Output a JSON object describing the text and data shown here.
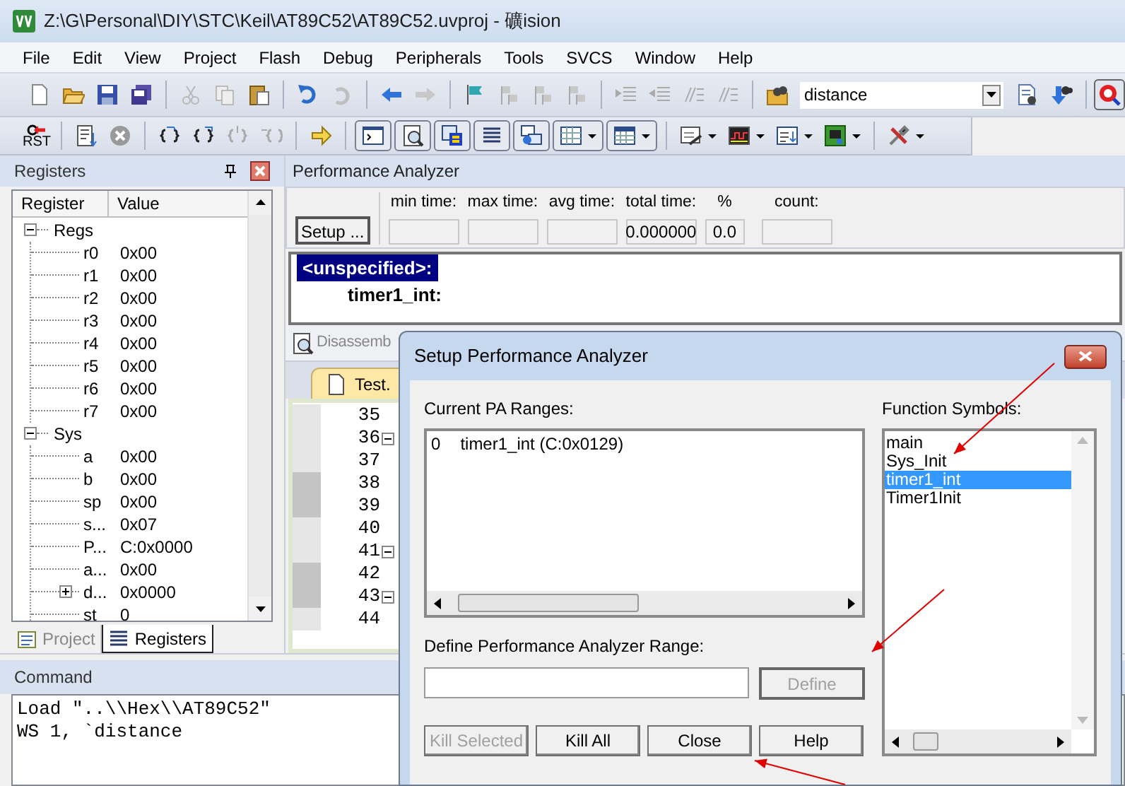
{
  "window": {
    "title": "Z:\\G\\Personal\\DIY\\STC\\Keil\\AT89C52\\AT89C52.uvproj - 礦ision"
  },
  "menu": [
    "File",
    "Edit",
    "View",
    "Project",
    "Flash",
    "Debug",
    "Peripherals",
    "Tools",
    "SVCS",
    "Window",
    "Help"
  ],
  "toolbar": {
    "search": {
      "value": "distance"
    },
    "reset_label": "RST"
  },
  "registers_panel": {
    "title": "Registers",
    "columns": [
      "Register",
      "Value"
    ],
    "tree": [
      {
        "name": "Regs",
        "expanded": true,
        "children": [
          {
            "name": "r0",
            "value": "0x00"
          },
          {
            "name": "r1",
            "value": "0x00"
          },
          {
            "name": "r2",
            "value": "0x00"
          },
          {
            "name": "r3",
            "value": "0x00"
          },
          {
            "name": "r4",
            "value": "0x00"
          },
          {
            "name": "r5",
            "value": "0x00"
          },
          {
            "name": "r6",
            "value": "0x00"
          },
          {
            "name": "r7",
            "value": "0x00"
          }
        ]
      },
      {
        "name": "Sys",
        "expanded": true,
        "children": [
          {
            "name": "a",
            "value": "0x00"
          },
          {
            "name": "b",
            "value": "0x00"
          },
          {
            "name": "sp",
            "value": "0x00"
          },
          {
            "name": "s...",
            "value": "0x07"
          },
          {
            "name": "P...",
            "value": "C:0x0000"
          },
          {
            "name": "a...",
            "value": "0x00"
          },
          {
            "name": "d...",
            "value": "0x0000",
            "expanded": false
          },
          {
            "name": "st",
            "value": "0"
          }
        ]
      }
    ],
    "tabs": [
      {
        "label": "Project",
        "selected": false
      },
      {
        "label": "Registers",
        "selected": true
      }
    ]
  },
  "performance_analyzer": {
    "title": "Performance Analyzer",
    "setup_button": "Setup ...",
    "fields": [
      {
        "label": "min time:"
      },
      {
        "label": "max time:"
      },
      {
        "label": "avg time:"
      },
      {
        "label": "total time:",
        "value": "0.000000"
      },
      {
        "label": "%",
        "value": "0.0"
      },
      {
        "label": "count:"
      }
    ],
    "ranges": [
      {
        "label": "<unspecified>:",
        "selected": true
      },
      {
        "label": "timer1_int:",
        "selected": false
      }
    ]
  },
  "disassembly_tab": {
    "label": "Disassemb"
  },
  "editor": {
    "tab": "Test.",
    "lines": [
      {
        "number": "35",
        "fold": false,
        "marked": false
      },
      {
        "number": "36",
        "fold": true,
        "marked": false
      },
      {
        "number": "37",
        "fold": false,
        "marked": false
      },
      {
        "number": "38",
        "fold": false,
        "marked": true
      },
      {
        "number": "39",
        "fold": false,
        "marked": true
      },
      {
        "number": "40",
        "fold": false,
        "marked": false
      },
      {
        "number": "41",
        "fold": true,
        "marked": false
      },
      {
        "number": "42",
        "fold": false,
        "marked": true
      },
      {
        "number": "43",
        "fold": true,
        "marked": true
      },
      {
        "number": "44",
        "fold": false,
        "marked": false
      }
    ]
  },
  "command": {
    "title": "Command",
    "lines": [
      "Load \"..\\\\Hex\\\\AT89C52\"",
      "WS 1, `distance"
    ]
  },
  "dialog": {
    "title": "Setup Performance Analyzer",
    "ranges_label": "Current PA Ranges:",
    "ranges": [
      {
        "index": "0",
        "text": "timer1_int (C:0x0129)"
      }
    ],
    "symbols_label": "Function Symbols:",
    "symbols": [
      {
        "label": "main",
        "selected": false
      },
      {
        "label": "Sys_Init",
        "selected": false
      },
      {
        "label": "timer1_int",
        "selected": true
      },
      {
        "label": "Timer1Init",
        "selected": false
      }
    ],
    "define_label": "Define Performance Analyzer Range:",
    "define_button": {
      "label": "Define",
      "disabled": true
    },
    "buttons": [
      {
        "label": "Kill Selected",
        "disabled": true
      },
      {
        "label": "Kill All",
        "disabled": false
      },
      {
        "label": "Close",
        "disabled": false
      },
      {
        "label": "Help",
        "disabled": false
      }
    ]
  }
}
